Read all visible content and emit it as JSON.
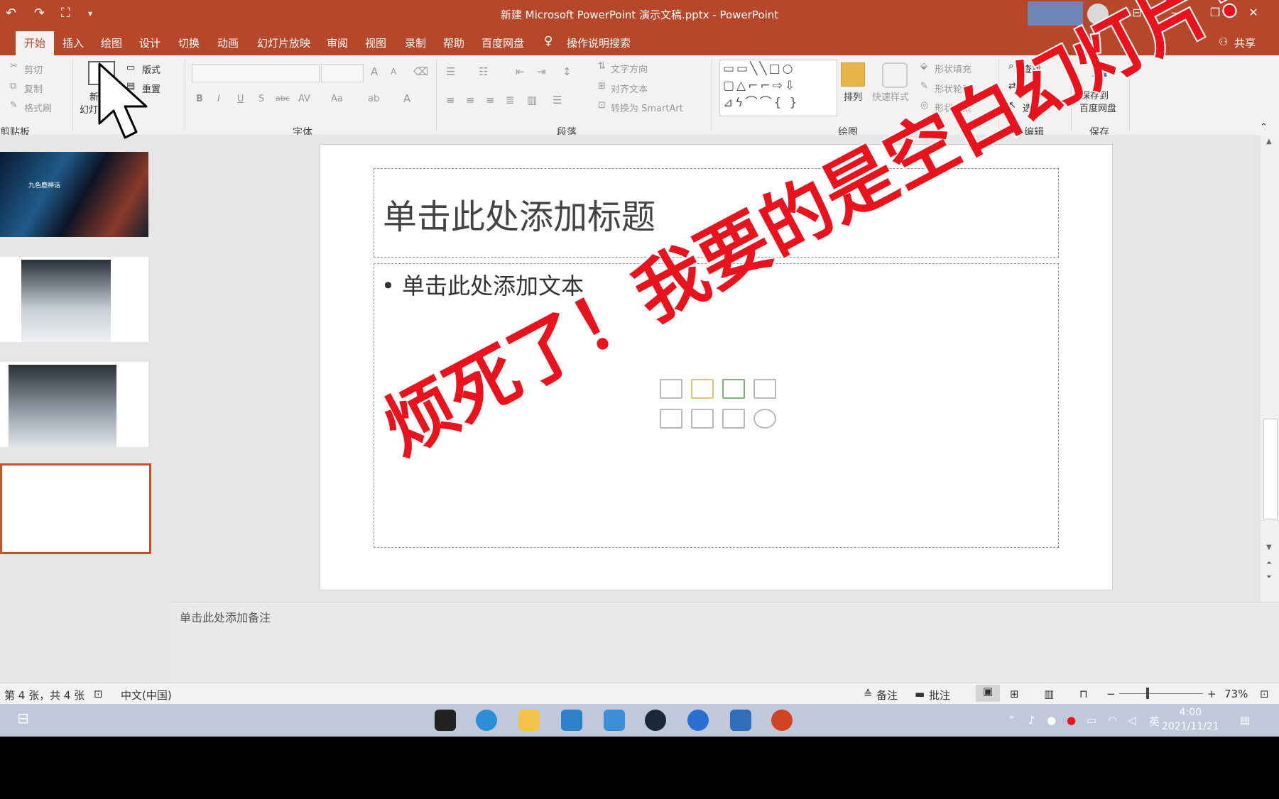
{
  "window": {
    "title": "新建 Microsoft PowerPoint 演示文稿.pptx  -  PowerPoint",
    "controls": [
      "⊟",
      "—",
      "❐",
      "✕"
    ]
  },
  "quick_access": {
    "undo": "↶",
    "redo": "↷",
    "present": "⛶",
    "more": "▾"
  },
  "tabs": [
    "开始",
    "插入",
    "绘图",
    "设计",
    "切换",
    "动画",
    "幻灯片放映",
    "审阅",
    "视图",
    "录制",
    "帮助",
    "百度网盘"
  ],
  "tell_me": "操作说明搜索",
  "share": "共享",
  "ribbon": {
    "clipboard": {
      "cut": "剪切",
      "copy": "复制",
      "format_painter": "格式刷",
      "group": "剪贴板"
    },
    "slides": {
      "new_slide": [
        "新建",
        "幻灯片"
      ],
      "layout": "版式",
      "reset": "重置"
    },
    "font": {
      "buttons": [
        "B",
        "I",
        "U",
        "S",
        "abc",
        "AV",
        "Aa",
        "ab",
        "A"
      ],
      "grow": "A",
      "shrink": "A",
      "group": "字体"
    },
    "paragraph": {
      "text_direction": "文字方向",
      "align_text": "对齐文本",
      "smartart": "转换为 SmartArt",
      "group": "段落"
    },
    "drawing": {
      "arrange": "排列",
      "quick_styles": "快速样式",
      "fill": "形状填充",
      "outline": "形状轮廓",
      "effects": "形状效果",
      "group": "绘图"
    },
    "editing": {
      "find": "查找",
      "replace": "替换",
      "select": "选择",
      "group": "编辑"
    },
    "save": {
      "button": [
        "保存到",
        "百度网盘"
      ],
      "group": "保存"
    }
  },
  "slide": {
    "title_placeholder": "单击此处添加标题",
    "body_placeholder": "• 单击此处添加文本"
  },
  "thumbnail_texts": {
    "slide1_title": "九色鹿神话"
  },
  "notes": "单击此处添加备注",
  "status": {
    "slide_count": "第 4 张，共 4 张",
    "language": "中文(中国)",
    "notes_btn": "备注",
    "comments_btn": "批注",
    "zoom": "73%",
    "zoom_minus": "−",
    "zoom_plus": "+"
  },
  "taskbar": {
    "tray_lang": "英",
    "time": "4:00",
    "date": "2021/11/21"
  },
  "overlay_text": "烦死了！我要的是空白幻灯片！",
  "colors": {
    "accent": "#b7472a",
    "overlay": "#e8131c",
    "selected_thumb": "#c3522f"
  }
}
